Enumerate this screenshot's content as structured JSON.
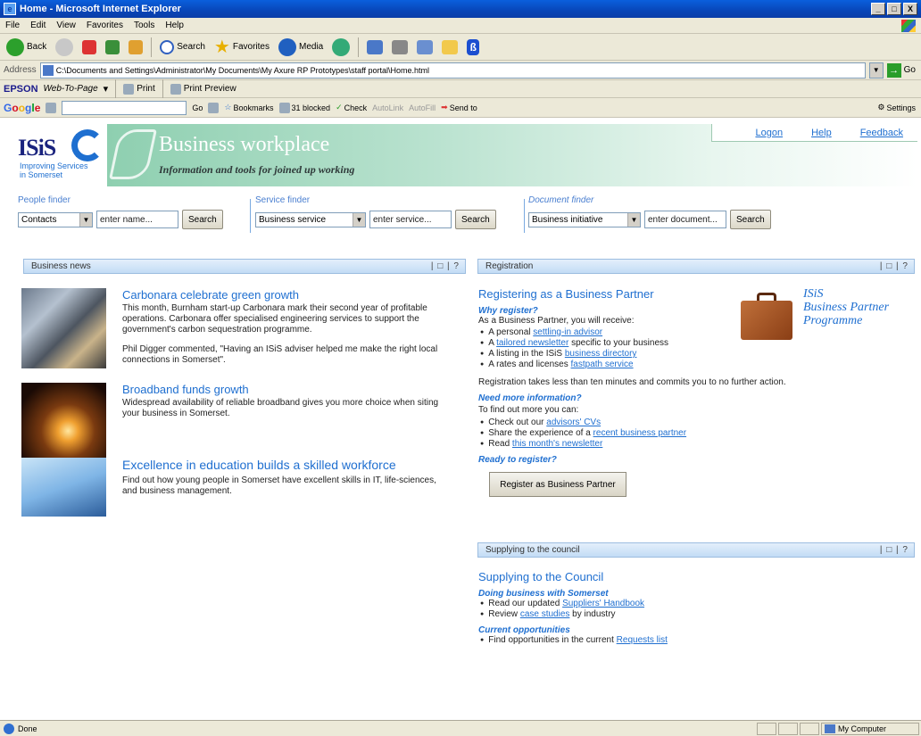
{
  "window": {
    "title": "Home - Microsoft Internet Explorer",
    "controls": [
      "_",
      "□",
      "X"
    ]
  },
  "menu": [
    "File",
    "Edit",
    "View",
    "Favorites",
    "Tools",
    "Help"
  ],
  "toolbar": {
    "back": "Back",
    "search": "Search",
    "favorites": "Favorites",
    "media": "Media"
  },
  "address": {
    "label": "Address",
    "value": "C:\\Documents and Settings\\Administrator\\My Documents\\My Axure RP Prototypes\\staff portal\\Home.html",
    "go": "Go"
  },
  "epson": {
    "brand": "EPSON",
    "web_to_page": "Web-To-Page",
    "print": "Print",
    "print_preview": "Print Preview"
  },
  "google": {
    "go": "Go",
    "bookmarks": "Bookmarks",
    "blocked": "31 blocked",
    "check": "Check",
    "autolink": "AutoLink",
    "autofill": "AutoFill",
    "send_to": "Send to",
    "settings": "Settings"
  },
  "header": {
    "logo": "ISiS",
    "logo_tag_1": "Improving Services",
    "logo_tag_2": "in Somerset",
    "title": "Business workplace",
    "subtitle": "Information and tools for joined up working",
    "links": {
      "logon": "Logon",
      "help": "Help",
      "feedback": "Feedback"
    }
  },
  "finders": {
    "people": {
      "label": "People finder",
      "select": "Contacts",
      "placeholder": "enter name...",
      "button": "Search"
    },
    "service": {
      "label": "Service finder",
      "select": "Business service",
      "placeholder": "enter service...",
      "button": "Search"
    },
    "document": {
      "label": "Document finder",
      "select": "Business initiative",
      "placeholder": "enter document...",
      "button": "Search"
    }
  },
  "panels": {
    "news": {
      "title": "Business news",
      "controls": "| □ | ?"
    },
    "registration": {
      "title": "Registration",
      "controls": "| □ | ?"
    },
    "supplying": {
      "title": "Supplying to the council",
      "controls": "| □ | ?"
    }
  },
  "news": [
    {
      "title": "Carbonara celebrate green growth",
      "body": "This month, Burnham start-up Carbonara mark their second year of profitable operations. Carbonara offer specialised engineering services to support the government's carbon sequestration programme.",
      "body2": "Phil Digger commented, \"Having an ISiS adviser helped me make the right local connections in Somerset\"."
    },
    {
      "title": "Broadband funds growth",
      "body": "Widespread availability of reliable broadband gives you more choice when siting your business in Somerset."
    },
    {
      "title": "Excellence in education builds a skilled workforce",
      "body": "Find out how young people in Somerset have excellent skills in IT, life-sciences, and business management."
    }
  ],
  "registration": {
    "title": "Registering as a Business Partner",
    "why": "Why register?",
    "intro": "As a Business Partner, you will receive:",
    "benefits": [
      {
        "pre": "A personal ",
        "link": "settling-in advisor",
        "post": ""
      },
      {
        "pre": "A ",
        "link": "tailored newsletter",
        "post": " specific to your business"
      },
      {
        "pre": "A listing in the ISiS ",
        "link": "business directory",
        "post": ""
      },
      {
        "pre": "A rates and licenses ",
        "link": "fastpath service",
        "post": ""
      }
    ],
    "note": "Registration takes less than ten minutes and commits you to no further action.",
    "more": "Need more information?",
    "more_intro": "To find out more you can:",
    "more_items": [
      {
        "pre": "Check out our ",
        "link": "advisors' CVs",
        "post": ""
      },
      {
        "pre": "Share the experience of a ",
        "link": "recent business partner",
        "post": ""
      },
      {
        "pre": "Read ",
        "link": "this month's newsletter",
        "post": ""
      }
    ],
    "ready": "Ready to register?",
    "button": "Register as Business Partner",
    "programme": [
      "ISiS",
      "Business Partner",
      "Programme"
    ]
  },
  "supplying": {
    "title": "Supplying to the Council",
    "doing": "Doing business with Somerset",
    "items": [
      {
        "pre": "Read our updated ",
        "link": "Suppliers' Handbook",
        "post": ""
      },
      {
        "pre": "Review ",
        "link": "case studies",
        "post": " by industry"
      }
    ],
    "current": "Current opportunities",
    "current_items": [
      {
        "pre": "Find opportunities in the current ",
        "link": "Requests list",
        "post": ""
      }
    ]
  },
  "status": {
    "text": "Done",
    "zone": "My Computer"
  }
}
